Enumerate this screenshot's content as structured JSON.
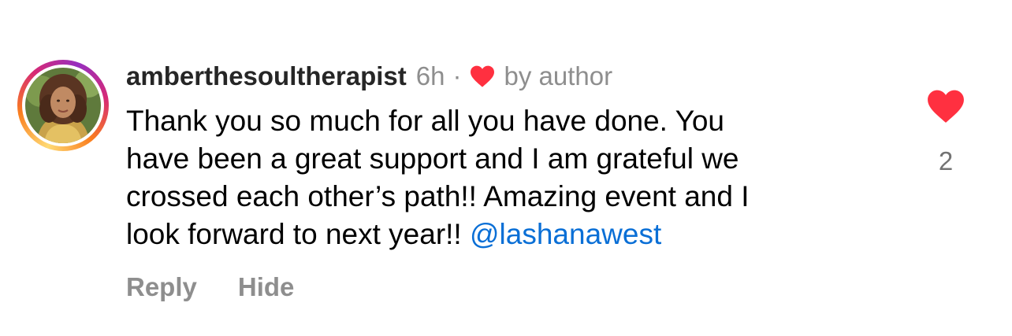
{
  "comment": {
    "username": "amberthesoultherapist",
    "time": "6h",
    "separator": "·",
    "liked_by_author_label": "by author",
    "text_lines": [
      "Thank you so much for all you have done. You",
      "have been a great support and I am grateful we",
      "crossed each other’s path!! Amazing event and I",
      "look forward to next year!! "
    ],
    "mention": "@lashanawest",
    "like_count": "2",
    "actions": {
      "reply_label": "Reply",
      "hide_label": "Hide"
    }
  },
  "icons": {
    "author_like": "heart-icon",
    "like_button": "heart-icon"
  },
  "colors": {
    "heart": "#ff3040",
    "mention": "#0a6fd6",
    "muted": "#8e8e8e"
  }
}
